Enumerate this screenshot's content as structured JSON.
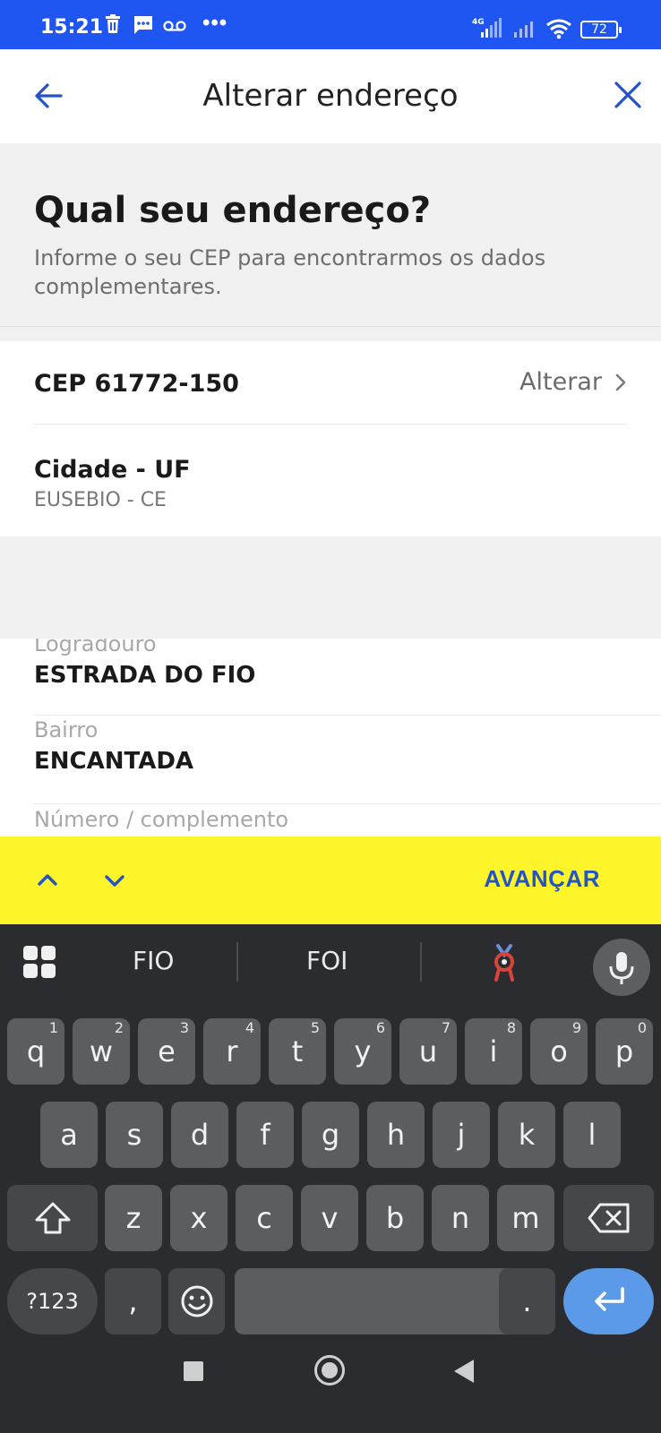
{
  "status_bar": {
    "time": "15:21",
    "battery": "72",
    "network": "4G",
    "more": "•••"
  },
  "header": {
    "title": "Alterar endereço",
    "back_icon": "arrow-left-icon",
    "close_icon": "close-icon"
  },
  "intro": {
    "heading": "Qual seu endereço?",
    "description": "Informe o seu CEP para encontrarmos os dados complementares."
  },
  "cep": {
    "label": "CEP 61772-150",
    "action": "Alterar"
  },
  "city": {
    "label": "Cidade - UF",
    "value": "EUSEBIO - CE"
  },
  "fields": [
    {
      "label": "Logradouro",
      "value": "ESTRADA DO  FIO"
    },
    {
      "label": "Bairro",
      "value": "ENCANTADA"
    },
    {
      "label": "Número / complemento",
      "value": ""
    }
  ],
  "accessory": {
    "next_label": "AVANÇAR"
  },
  "keyboard": {
    "suggestions": [
      "FIO",
      "FOI"
    ],
    "row1": [
      {
        "k": "q",
        "n": "1"
      },
      {
        "k": "w",
        "n": "2"
      },
      {
        "k": "e",
        "n": "3"
      },
      {
        "k": "r",
        "n": "4"
      },
      {
        "k": "t",
        "n": "5"
      },
      {
        "k": "y",
        "n": "6"
      },
      {
        "k": "u",
        "n": "7"
      },
      {
        "k": "i",
        "n": "8"
      },
      {
        "k": "o",
        "n": "9"
      },
      {
        "k": "p",
        "n": "0"
      }
    ],
    "row2": [
      "a",
      "s",
      "d",
      "f",
      "g",
      "h",
      "j",
      "k",
      "l"
    ],
    "row3": [
      "z",
      "x",
      "c",
      "v",
      "b",
      "n",
      "m"
    ],
    "symbols_label": "?123",
    "comma": ",",
    "period": "."
  },
  "colors": {
    "status_bar": "#1f56f2",
    "accent_blue": "#2253c9",
    "accessory_bar": "#fdf42a",
    "keyboard_bg": "#2a2c30",
    "enter_key": "#5b9ae8"
  }
}
